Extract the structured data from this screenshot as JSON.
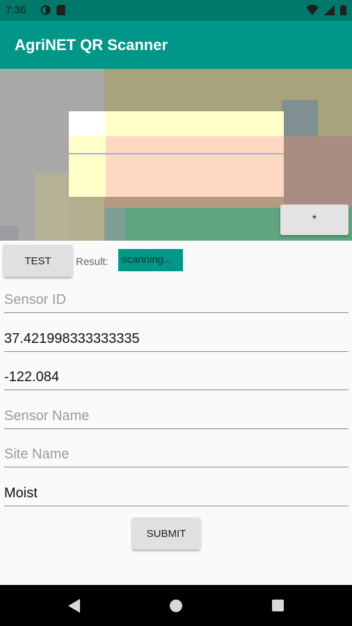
{
  "status_bar": {
    "time": "7:36",
    "icons_left": [
      "data-saver-icon",
      "sd-card-icon"
    ],
    "icons_right": [
      "wifi-icon",
      "cellular-signal-icon",
      "battery-icon"
    ]
  },
  "app_bar": {
    "title": "AgriNET QR Scanner"
  },
  "camera": {
    "star_button_label": "*"
  },
  "controls": {
    "test_button_label": "TEST",
    "result_label": "Result:",
    "result_value": "scanning..."
  },
  "form": {
    "sensor_id_placeholder": "Sensor ID",
    "latitude_value": "37.421998333333335",
    "longitude_value": "-122.084",
    "sensor_name_placeholder": "Sensor Name",
    "site_name_placeholder": "Site Name",
    "moisture_value": "Moist",
    "submit_label": "SUBMIT"
  },
  "colors": {
    "primary": "#009688",
    "primary_dark": "#00796b"
  }
}
